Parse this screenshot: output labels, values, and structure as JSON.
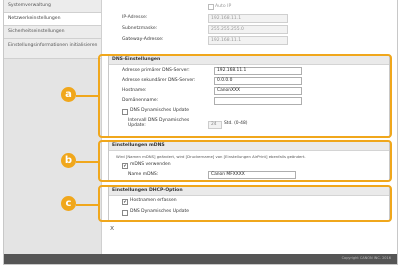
{
  "sidebar": {
    "items": [
      {
        "label": "Systemverwaltung"
      },
      {
        "label": "Netzwerkeinstellungen"
      },
      {
        "label": "Sicherheitseinstellungen"
      },
      {
        "label": "Einstellungsinformationen initialisieren"
      }
    ]
  },
  "ipv4": {
    "auto_ip_label": "Auto IP",
    "ip_label": "IP-Adresse:",
    "ip_value": "192.168.11.1",
    "subnet_label": "Subnetzmaske:",
    "subnet_value": "255.255.255.0",
    "gateway_label": "Gateway-Adresse:",
    "gateway_value": "192.168.11.1"
  },
  "dns": {
    "title": "DNS-Einstellungen",
    "primary_label": "Adresse primärer DNS-Server:",
    "primary_value": "192.168.11.1",
    "secondary_label": "Adresse sekundärer DNS-Server:",
    "secondary_value": "0.0.0.0",
    "hostname_label": "Hostname:",
    "hostname_value": "CanonXXX",
    "domain_label": "Domänenname:",
    "domain_value": "",
    "dynamic_update_label": "DNS Dynamisches Update",
    "dynamic_update_checked": false,
    "interval_label": "Intervall DNS Dynamisches Update:",
    "interval_value": "24",
    "interval_unit": "Std. (0-48)"
  },
  "mdns": {
    "title": "Einstellungen mDNS",
    "note": "Wird [Namen mDNS] geändert, wird [Druckername] von [Einstellungen AirPrint] ebenfalls geändert.",
    "use_label": "mDNS verwenden",
    "use_checked": true,
    "name_label": "Name mDNS:",
    "name_value": "Canon MFXXXX"
  },
  "dhcp": {
    "title": "Einstellungen DHCP-Option",
    "hostname_label": "Hostnamen erfassen",
    "hostname_checked": true,
    "dynamic_update_label": "DNS Dynamisches Update",
    "dynamic_update_checked": false
  },
  "callouts": {
    "a": "a",
    "b": "b",
    "c": "c"
  },
  "footer": {
    "copyright": "Copyright CANON INC. 2016"
  },
  "misc": {
    "bottom_marker": "x"
  },
  "colors": {
    "accent": "#f0a71c",
    "footer": "#555555"
  }
}
